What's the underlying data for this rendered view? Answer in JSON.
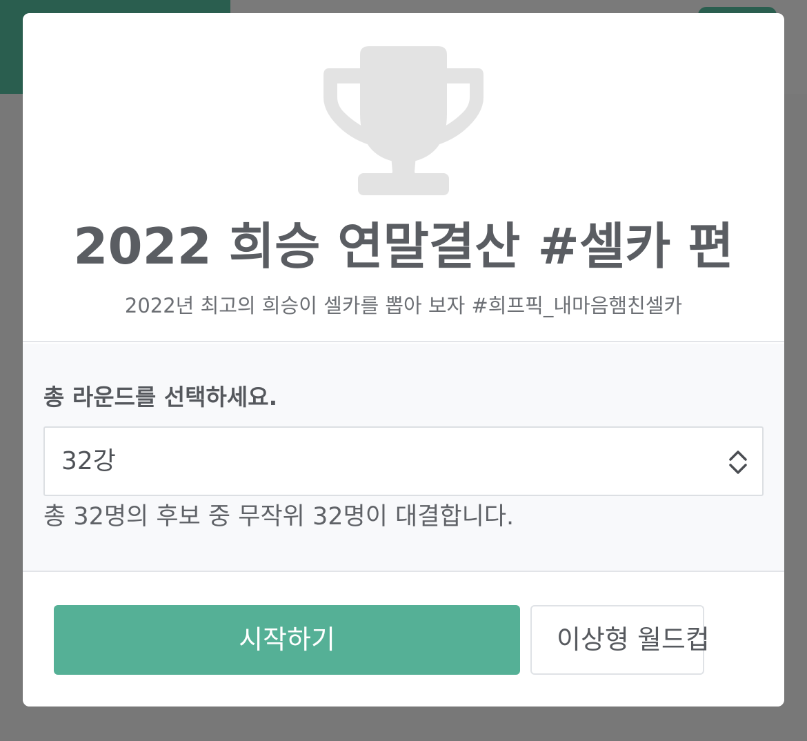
{
  "modal": {
    "title": "2022 희승 연말결산 #셀카 편",
    "subtitle": "2022년 최고의 희승이 셀카를 뽑아 보자 #희프픽_내마음햄친셀카",
    "trophy_icon": "trophy-icon",
    "round": {
      "label": "총 라운드를 선택하세요.",
      "selected_value": "32강",
      "description": "총 32명의 후보 중 무작위 32명이 대결합니다."
    },
    "buttons": {
      "start_label": "시작하기",
      "worldcup_label": "이상형 월드컵"
    }
  },
  "colors": {
    "accent": "#55b096",
    "header_bg": "#2a5e4f",
    "trophy": "#e3e3e3",
    "overlay": "#7b7b7b"
  }
}
